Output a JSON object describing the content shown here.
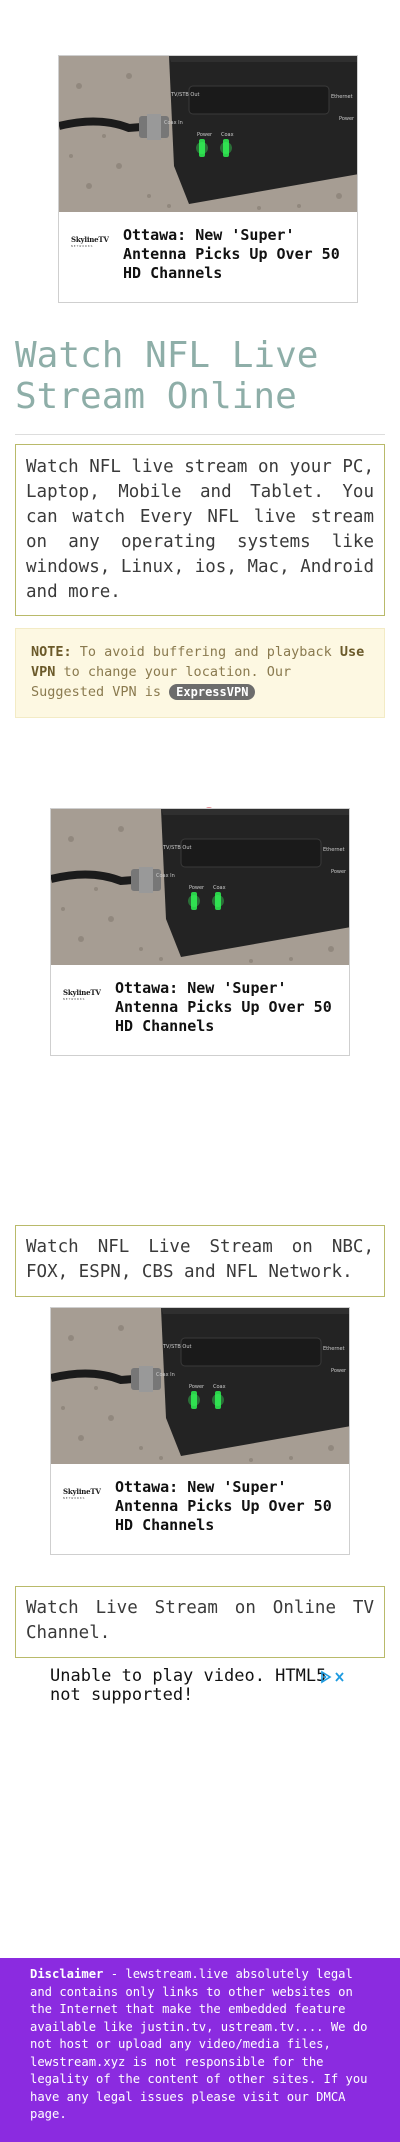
{
  "ads": [
    {
      "title": "Ottawa: New 'Super' Antenna Picks Up Over 50 HD Channels",
      "logo_text": "SkylineTV",
      "logo_sub": "NETWORKS",
      "device_labels": [
        "TV/STB Out",
        "Ethernet",
        "Coax In",
        "Power",
        "Power",
        "Coax"
      ]
    },
    {
      "title": "Ottawa: New 'Super' Antenna Picks Up Over 50 HD Channels",
      "logo_text": "SkylineTV",
      "logo_sub": "NETWORKS",
      "device_labels": [
        "TV/STB Out",
        "Ethernet",
        "Coax In",
        "Power",
        "Power",
        "Coax"
      ]
    },
    {
      "title": "Ottawa: New 'Super' Antenna Picks Up Over 50 HD Channels",
      "logo_text": "SkylineTV",
      "logo_sub": "NETWORKS",
      "device_labels": [
        "TV/STB Out",
        "Ethernet",
        "Coax In",
        "Power",
        "Power",
        "Coax"
      ]
    }
  ],
  "heading": "Watch NFL Live Stream Online",
  "intro": "Watch NFL live stream on your PC, Laptop, Mobile and Tablet. You can watch Every NFL live stream on any operating systems like windows, Linux, ios, Mac, Android and more.",
  "note": {
    "label": "NOTE:",
    "text1": " To avoid buffering and playback ",
    "strong": "Use VPN",
    "text2": " to change your location. Our Suggested VPN is ",
    "vpn": "ExpressVPN"
  },
  "box2": "Watch NFL Live Stream on NBC, FOX, ESPN, CBS and NFL Network.",
  "box3": "Watch Live Stream on Online TV Channel.",
  "video_msg": "Unable to play video. HTML5 not supported!",
  "footer": {
    "label": "Disclaimer",
    "text": " - lewstream.live absolutely legal and contains only links to other websites on the Internet that make the embedded feature available like justin.tv, ustream.tv.... We do not host or upload any video/media files, lewstream.xyz is not responsible for the legality of the content of other sites. If you have any legal issues please visit our DMCA page."
  },
  "colors": {
    "heading": "#8eaea8",
    "box_border": "#b9ba6a",
    "note_bg": "#fdf8e2",
    "footer_bg": "#8b2be0",
    "close_icon": "#c8202a"
  }
}
